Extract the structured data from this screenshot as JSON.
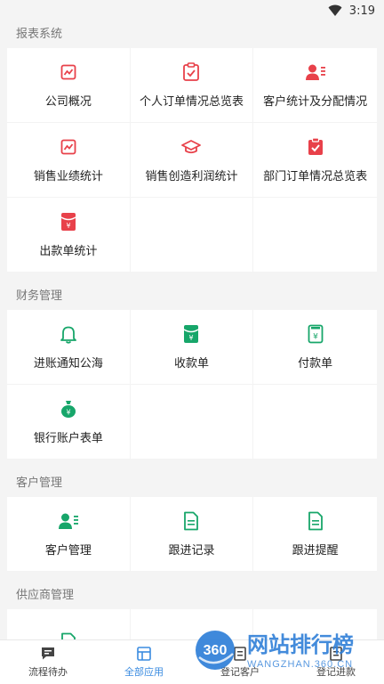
{
  "status": {
    "time": "3:19"
  },
  "colors": {
    "red": "#e8414a",
    "green": "#17a66a",
    "blue": "#3a8be0"
  },
  "sections": [
    {
      "title": "报表系统",
      "items": [
        {
          "label": "公司概况",
          "icon": "chart-icon"
        },
        {
          "label": "个人订单情况总览表",
          "icon": "clipboard-check-icon"
        },
        {
          "label": "客户统计及分配情况",
          "icon": "user-card-icon"
        },
        {
          "label": "销售业绩统计",
          "icon": "chart-icon"
        },
        {
          "label": "销售创造利润统计",
          "icon": "graduation-cap-icon"
        },
        {
          "label": "部门订单情况总览表",
          "icon": "clipboard-check-icon"
        },
        {
          "label": "出款单统计",
          "icon": "yuan-envelope-icon"
        }
      ]
    },
    {
      "title": "财务管理",
      "items": [
        {
          "label": "进账通知公海",
          "icon": "bell-icon"
        },
        {
          "label": "收款单",
          "icon": "yuan-envelope-icon"
        },
        {
          "label": "付款单",
          "icon": "yuan-receipt-icon"
        },
        {
          "label": "银行账户表单",
          "icon": "money-bag-icon"
        }
      ]
    },
    {
      "title": "客户管理",
      "items": [
        {
          "label": "客户管理",
          "icon": "user-card-icon"
        },
        {
          "label": "跟进记录",
          "icon": "document-icon"
        },
        {
          "label": "跟进提醒",
          "icon": "document-icon"
        }
      ]
    },
    {
      "title": "供应商管理",
      "items": [
        {
          "label": "",
          "icon": "document-icon"
        }
      ]
    }
  ],
  "tabbar": [
    {
      "label": "流程待办",
      "icon": "chat-icon",
      "active": false
    },
    {
      "label": "全部应用",
      "icon": "apps-icon",
      "active": true
    },
    {
      "label": "登记客户",
      "icon": "register-icon",
      "active": false
    },
    {
      "label": "登记进款",
      "icon": "payment-icon",
      "active": false
    }
  ],
  "watermark": {
    "badge": "360",
    "title": "网站排行榜",
    "url": "WANGZHAN.360.CN"
  }
}
